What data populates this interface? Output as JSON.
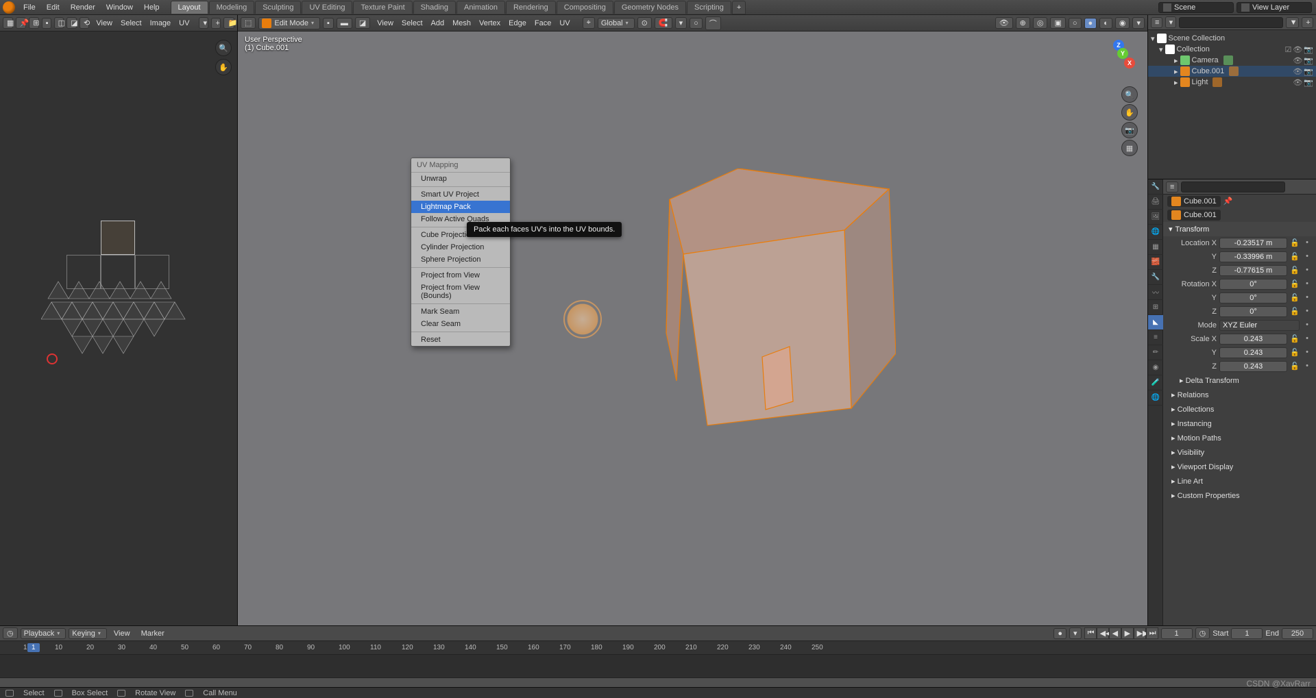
{
  "menubar": {
    "menus": [
      "File",
      "Edit",
      "Render",
      "Window",
      "Help"
    ],
    "workspaces": [
      "Layout",
      "Modeling",
      "Sculpting",
      "UV Editing",
      "Texture Paint",
      "Shading",
      "Animation",
      "Rendering",
      "Compositing",
      "Geometry Nodes",
      "Scripting"
    ],
    "active_workspace": 0,
    "scene_label": "Scene",
    "layer_label": "View Layer"
  },
  "uv_editor": {
    "menus": [
      "View",
      "Select",
      "Image",
      "UV"
    ]
  },
  "viewport": {
    "mode": "Edit Mode",
    "menus": [
      "View",
      "Select",
      "Add",
      "Mesh",
      "Vertex",
      "Edge",
      "Face",
      "UV"
    ],
    "orientation": "Global",
    "info1": "User Perspective",
    "info2": "(1) Cube.001"
  },
  "context_menu": {
    "title": "UV Mapping",
    "items": [
      "Unwrap",
      "Smart UV Project",
      "Lightmap Pack",
      "Follow Active Quads",
      "Cube Projection",
      "Cylinder Projection",
      "Sphere Projection",
      "Project from View",
      "Project from View (Bounds)",
      "Mark Seam",
      "Clear Seam",
      "Reset"
    ],
    "highlighted": 2,
    "separators_after": [
      0,
      3,
      6,
      8,
      10
    ],
    "tooltip": "Pack each faces UV's into the UV bounds."
  },
  "outliner": {
    "root": "Scene Collection",
    "collection": "Collection",
    "items": [
      {
        "name": "Camera",
        "type": "camera"
      },
      {
        "name": "Cube.001",
        "type": "mesh",
        "active": true
      },
      {
        "name": "Light",
        "type": "light"
      }
    ],
    "search_placeholder": ""
  },
  "properties": {
    "search_placeholder": "",
    "crumb1": "Cube.001",
    "crumb2": "Cube.001",
    "transform_label": "Transform",
    "location": {
      "label": "Location X",
      "x": "-0.23517 m",
      "y": "-0.33996 m",
      "z": "-0.77615 m"
    },
    "rotation": {
      "label": "Rotation X",
      "x": "0°",
      "y": "0°",
      "z": "0°"
    },
    "mode_label": "Mode",
    "mode_value": "XYZ Euler",
    "scale": {
      "label": "Scale X",
      "x": "0.243",
      "y": "0.243",
      "z": "0.243"
    },
    "panels": [
      "Delta Transform",
      "Relations",
      "Collections",
      "Instancing",
      "Motion Paths",
      "Visibility",
      "Viewport Display",
      "Line Art",
      "Custom Properties"
    ]
  },
  "timeline": {
    "playback": "Playback",
    "keying": "Keying",
    "view": "View",
    "marker": "Marker",
    "current": "1",
    "start_label": "Start",
    "start": "1",
    "end_label": "End",
    "end": "250",
    "ticks": [
      "1",
      "10",
      "20",
      "30",
      "40",
      "50",
      "60",
      "70",
      "80",
      "90",
      "100",
      "110",
      "120",
      "130",
      "140",
      "150",
      "160",
      "170",
      "180",
      "190",
      "200",
      "210",
      "220",
      "230",
      "240",
      "250"
    ]
  },
  "status": {
    "select": "Select",
    "box": "Box Select",
    "rotate": "Rotate View",
    "menu": "Call Menu"
  },
  "watermark": "CSDN @XavRarr"
}
